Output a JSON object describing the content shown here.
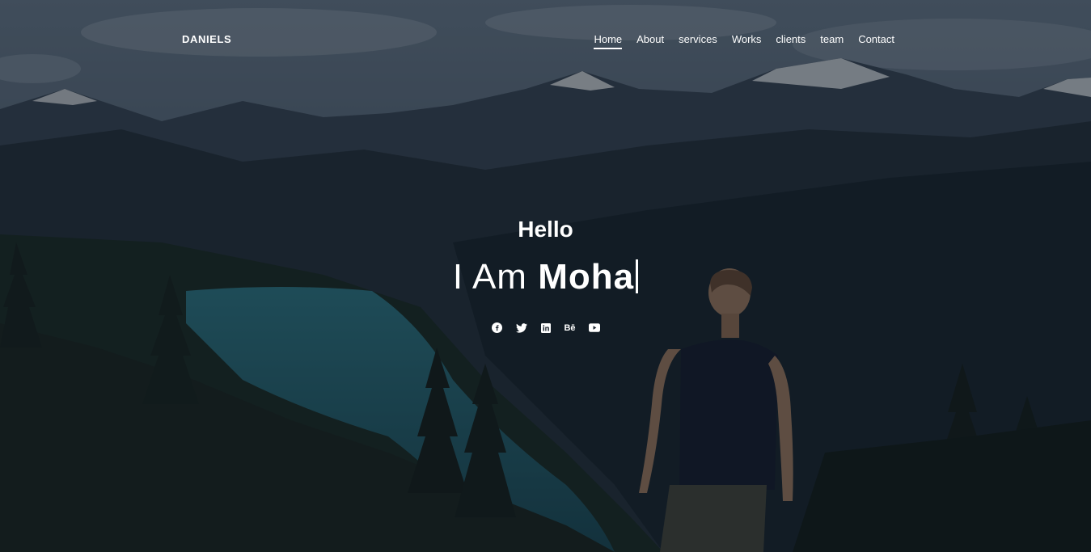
{
  "nav": {
    "brand": "DANIELS",
    "links": [
      "Home",
      "About",
      "services",
      "Works",
      "clients",
      "team",
      "Contact"
    ],
    "active": "Home"
  },
  "hero": {
    "greeting": "Hello",
    "headline_prefix": "I Am",
    "headline_name": "Moha"
  },
  "socials": [
    {
      "icon": "facebook-icon"
    },
    {
      "icon": "twitter-icon"
    },
    {
      "icon": "linkedin-icon"
    },
    {
      "icon": "behance-icon",
      "glyph": "Bē"
    },
    {
      "icon": "youtube-icon"
    }
  ],
  "colors": {
    "text": "#ffffff",
    "overlay": "#0b1420"
  }
}
